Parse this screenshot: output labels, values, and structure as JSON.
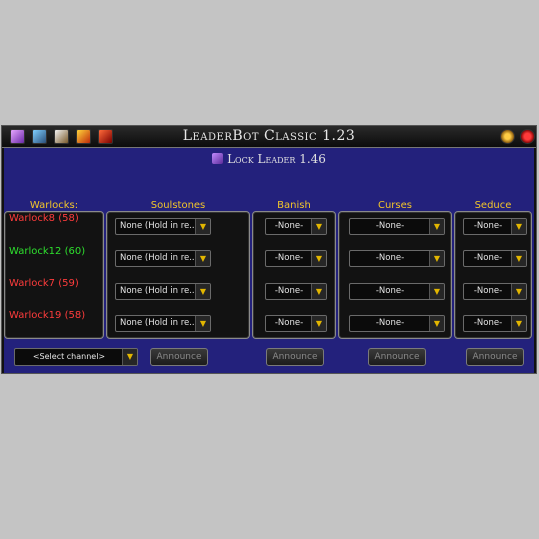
{
  "window": {
    "title": "LeaderBot Classic 1.23",
    "subtitle": "Lock Leader 1.46"
  },
  "toolbar_icons": [
    "warlock-icon",
    "hunter-icon",
    "sword-icon",
    "fire-icon",
    "rage-icon"
  ],
  "columns": {
    "warlocks": "Warlocks:",
    "soulstones": "Soulstones",
    "banish": "Banish",
    "curses": "Curses",
    "seduce": "Seduce"
  },
  "warlocks": [
    {
      "name": "Warlock8 (58)",
      "color": "#ff3c3c"
    },
    {
      "name": "Warlock12 (60)",
      "color": "#2ee02e"
    },
    {
      "name": "Warlock7 (59)",
      "color": "#ff3c3c"
    },
    {
      "name": "Warlock19 (58)",
      "color": "#ff3c3c"
    }
  ],
  "soulstones": [
    "None (Hold in re...",
    "None (Hold in re...",
    "None (Hold in re...",
    "None (Hold in re..."
  ],
  "banish": [
    "-None-",
    "-None-",
    "-None-",
    "-None-"
  ],
  "curses": [
    "-None-",
    "-None-",
    "-None-",
    "-None-"
  ],
  "seduce": [
    "-None-",
    "-None-",
    "-None-",
    "-None-"
  ],
  "footer": {
    "channel": "<Select channel>",
    "announce": "Announce"
  },
  "colors": {
    "header_gold": "#f3c62a",
    "body_blue": "#23217c"
  }
}
